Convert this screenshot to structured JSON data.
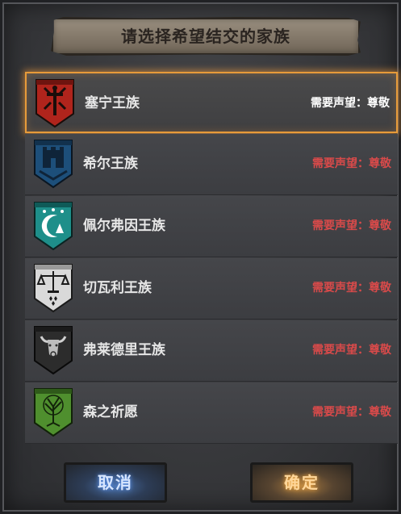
{
  "title": "请选择希望结交的家族",
  "families": [
    {
      "name": "塞宁王族",
      "requirement": "需要声望：尊敬",
      "requirement_met": true,
      "crest": "sword-crest-icon",
      "crest_color": "#b0241c",
      "selected": true
    },
    {
      "name": "希尔王族",
      "requirement": "需要声望：尊敬",
      "requirement_met": false,
      "crest": "castle-crest-icon",
      "crest_color": "#1d4f7a",
      "selected": false
    },
    {
      "name": "佩尔弗因王族",
      "requirement": "需要声望：尊敬",
      "requirement_met": false,
      "crest": "moon-crest-icon",
      "crest_color": "#1e8f8a",
      "selected": false
    },
    {
      "name": "切瓦利王族",
      "requirement": "需要声望：尊敬",
      "requirement_met": false,
      "crest": "scales-crest-icon",
      "crest_color": "#d9d9d9",
      "selected": false
    },
    {
      "name": "弗莱德里王族",
      "requirement": "需要声望：尊敬",
      "requirement_met": false,
      "crest": "bull-crest-icon",
      "crest_color": "#2c2c2c",
      "selected": false
    },
    {
      "name": "森之祈愿",
      "requirement": "需要声望：尊敬",
      "requirement_met": false,
      "crest": "tree-crest-icon",
      "crest_color": "#4f8f2e",
      "selected": false
    }
  ],
  "buttons": {
    "cancel": "取消",
    "confirm": "确定"
  },
  "colors": {
    "selection_border": "#e79b3a",
    "requirement_unmet": "#d94a4a",
    "requirement_met": "#ffffff"
  }
}
